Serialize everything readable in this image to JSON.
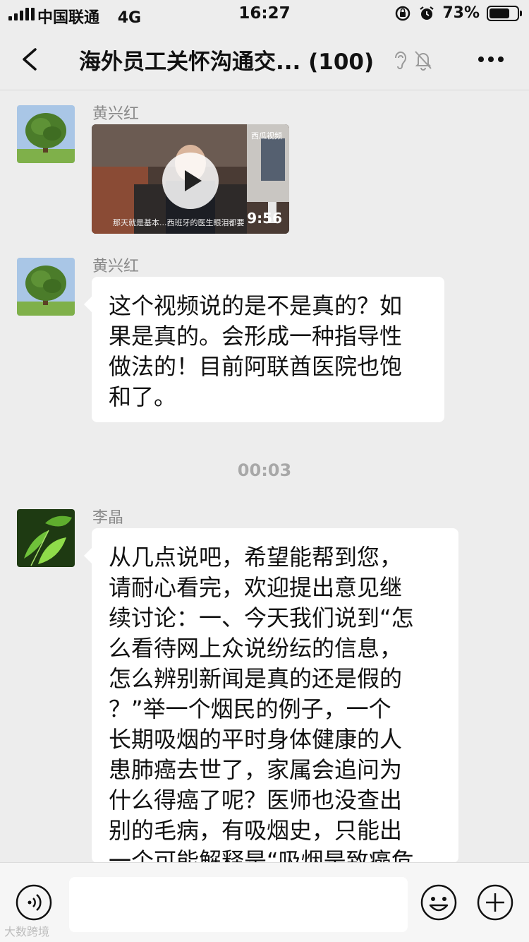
{
  "status_bar": {
    "carrier": "中国联通",
    "network": "4G",
    "time": "16:27",
    "battery_percent": "73%",
    "battery_level": 0.73
  },
  "header": {
    "title": "海外员工关怀沟通交... (100)",
    "back_icon": "chevron-left-icon",
    "ear_icon": "ear-icon",
    "mute_icon": "bell-muted-icon",
    "more_icon": "ellipsis-icon"
  },
  "messages": [
    {
      "sender": "黄兴红",
      "type": "video",
      "video": {
        "duration": "9:56",
        "source": "西瓜视频",
        "caption": "那天就是基本...西班牙的医生眼泪都要"
      }
    },
    {
      "sender": "黄兴红",
      "type": "text",
      "lines": [
        "这个视频说的是不是真的？如",
        "果是真的。会形成一种指导性",
        "做法的！目前阿联酋医院也饱",
        "和了。"
      ]
    },
    {
      "type": "time",
      "text": "00:03"
    },
    {
      "sender": "李晶",
      "type": "text",
      "lines": [
        "从几点说吧，希望能帮到您，",
        "请耐心看完，欢迎提出意见继",
        "续讨论：一、今天我们说到“怎",
        "么看待网上众说纷纭的信息，",
        "怎么辨别新闻是真的还是假的",
        "？”举一个烟民的例子，一个",
        "长期吸烟的平时身体健康的人",
        "患肺癌去世了，家属会追问为",
        "什么得癌了呢？医师也没查出",
        "别的毛病，有吸烟史，只能出",
        "一个可能解释是“吸烟是致癌危"
      ]
    }
  ],
  "input_bar": {
    "voice_icon": "voice-icon",
    "emoji_icon": "emoji-icon",
    "add_icon": "plus-circle-icon",
    "placeholder": ""
  },
  "watermark": "大数跨境"
}
